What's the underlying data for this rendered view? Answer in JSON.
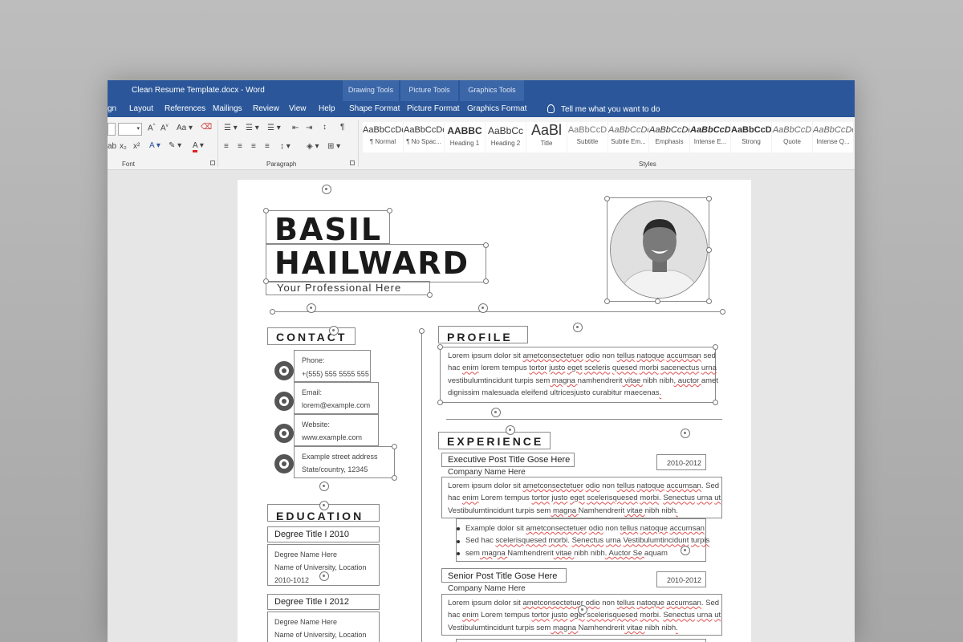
{
  "window": {
    "title": "Clean Resume Template.docx - Word",
    "contextual": [
      {
        "group": "Drawing Tools",
        "tab": "Shape Format"
      },
      {
        "group": "Picture Tools",
        "tab": "Picture Format"
      },
      {
        "group": "Graphics Tools",
        "tab": "Graphics Format"
      }
    ],
    "tabs": [
      "gn",
      "Layout",
      "References",
      "Mailings",
      "Review",
      "View",
      "Help"
    ],
    "tell_me": "Tell me what you want to do"
  },
  "ribbon": {
    "groups": {
      "font": "Font",
      "paragraph": "Paragraph",
      "styles": "Styles"
    },
    "styles": [
      {
        "sample": "AaBbCcDc",
        "name": "¶ Normal"
      },
      {
        "sample": "AaBbCcDc",
        "name": "¶ No Spac..."
      },
      {
        "sample": "AABBC",
        "name": "Heading 1"
      },
      {
        "sample": "AaBbCc",
        "name": "Heading 2"
      },
      {
        "sample": "AaBl",
        "name": "Title"
      },
      {
        "sample": "AaBbCcD",
        "name": "Subtitle"
      },
      {
        "sample": "AaBbCcDc",
        "name": "Subtle Em..."
      },
      {
        "sample": "AaBbCcDc",
        "name": "Emphasis"
      },
      {
        "sample": "AaBbCcDc",
        "name": "Intense E..."
      },
      {
        "sample": "AaBbCcDc",
        "name": "Strong"
      },
      {
        "sample": "AaBbCcD",
        "name": "Quote"
      },
      {
        "sample": "AaBbCcDc",
        "name": "Intense Q..."
      }
    ]
  },
  "resume": {
    "first_name": "BASIL",
    "last_name": "HAILWARD",
    "tagline": "Your Professional Here",
    "contact": {
      "title": "CONTACT",
      "phone_label": "Phone:",
      "phone": "+(555) 555 5555 555",
      "email_label": "Email:",
      "email": "lorem@example.com",
      "website_label": "Website:",
      "website": "www.example.com",
      "address1": "Example street address",
      "address2": "State/country, 12345"
    },
    "education": {
      "title": "EDUCATION",
      "items": [
        {
          "degree": "Degree Title I 2010",
          "name": "Degree Name Here",
          "school": "Name of University, Location",
          "years": "2010-1012"
        },
        {
          "degree": "Degree Title I 2012",
          "name": "Degree Name Here",
          "school": "Name of University, Location"
        }
      ]
    },
    "profile": {
      "title": "PROFILE",
      "lines": [
        [
          "Lorem ipsum dolor sit ",
          "ametconsectetuer",
          " ",
          "odio",
          " non ",
          "tellus",
          " ",
          "natoque",
          " ",
          "accumsan",
          " sed"
        ],
        [
          "hac ",
          "enim",
          " lorem tempus ",
          "tortor",
          " ",
          "justo",
          " ",
          "eget",
          " ",
          "sceleris",
          " ",
          "quesed",
          " ",
          "morbi",
          " ",
          "sacenectus",
          " ",
          "urna"
        ],
        [
          "vestibulumtincidunt",
          " ",
          "turpis",
          " ",
          "sem",
          " magna ",
          "namhendrerit",
          " vitae ",
          "nibh",
          " ",
          "nibh",
          ", auctor ",
          "amet"
        ],
        [
          "dignissim",
          " ",
          "malesuada",
          " ",
          "eleifend",
          " ",
          "ultricesjusto",
          " ",
          "curabitur",
          " ",
          "maecenas",
          "."
        ]
      ]
    },
    "experience": {
      "title": "EXPERIENCE",
      "jobs": [
        {
          "title": "Executive Post Title Gose Here",
          "company": "Company Name Here",
          "years": "2010-2012",
          "lines": [
            [
              "Lorem ipsum dolor sit ",
              "ametconsectetuer",
              " ",
              "odio",
              " non ",
              "tellus",
              " ",
              "natoque",
              " ",
              "accumsan",
              ". Sed"
            ],
            [
              "hac ",
              "enim",
              " Lorem tempus ",
              "tortor",
              " ",
              "justo",
              " ",
              "eget",
              " ",
              "scelerisquesed",
              " ",
              "morbi",
              ". ",
              "Senectus",
              " ",
              "urna",
              " ",
              "ut"
            ],
            [
              "Vestibulumtincidunt",
              " ",
              "turpis",
              " ",
              "sem",
              " magna ",
              "Namhendrerit",
              " vitae ",
              "nibh",
              " ",
              "nibh",
              "."
            ]
          ],
          "bullets": [
            [
              "Example dolor sit ",
              "ametconsectetuer",
              " ",
              "odio",
              " non ",
              "tellus",
              " ",
              "natoque",
              " ",
              "accumsan"
            ],
            [
              "Sed hac ",
              "scelerisquesed",
              " ",
              "morbi",
              ". ",
              "Senectus",
              " ",
              "urna",
              " ",
              "Vestibulumtincidunt",
              " ",
              "turpis"
            ],
            [
              "sem",
              " magna ",
              "Namhendrerit",
              " vitae ",
              "nibh",
              " ",
              "nibh",
              ". Auctor Se ",
              "aquam"
            ]
          ]
        },
        {
          "title": "Senior Post Title Gose Here",
          "company": "Company Name Here",
          "years": "2010-2012",
          "lines": [
            [
              "Lorem ipsum dolor sit ",
              "ametconsectetuer",
              " ",
              "odio",
              " non ",
              "tellus",
              " ",
              "natoque",
              " ",
              "accumsan",
              ". Sed"
            ],
            [
              "hac ",
              "enim",
              " Lorem tempus ",
              "tortor",
              " ",
              "justo",
              " ",
              "eget",
              " ",
              "scelerisquesed",
              " ",
              "morbi",
              ". ",
              "Senectus",
              " ",
              "urna",
              " ",
              "ut"
            ],
            [
              "Vestibulumtincidunt",
              " ",
              "turpis",
              " ",
              "sem",
              " magna ",
              "Namhendrerit",
              " vitae ",
              "nibh",
              " ",
              "nibh",
              "."
            ]
          ]
        }
      ]
    }
  }
}
